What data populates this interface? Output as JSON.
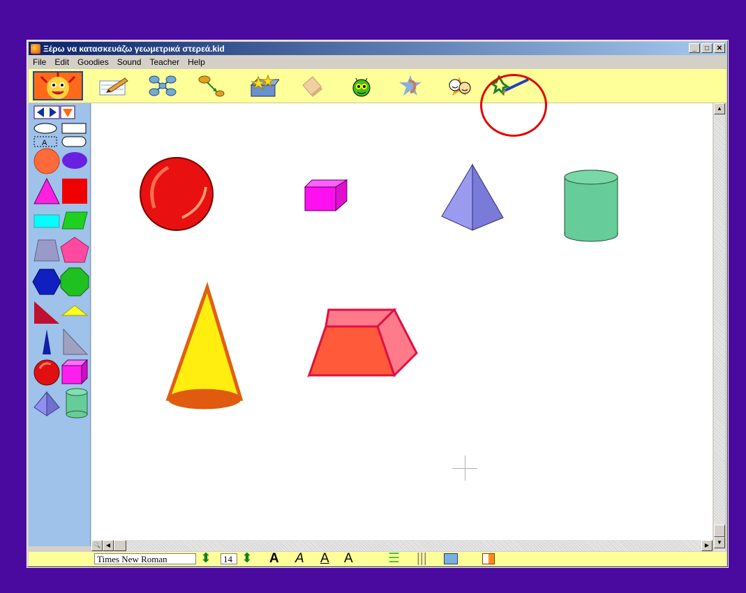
{
  "window": {
    "title": "Ξέρω να κατασκευάζω γεωμετρικά στερεά.kid",
    "controls": {
      "minimize": "_",
      "maximize": "□",
      "close": "✕"
    }
  },
  "menu": [
    "File",
    "Edit",
    "Goodies",
    "Sound",
    "Teacher",
    "Help"
  ],
  "toolbar": {
    "icons": [
      "mascot-icon",
      "pencil-paper-icon",
      "network-icon",
      "link-icon",
      "stamp-box-icon",
      "eraser-icon",
      "face-icon",
      "ear-icon",
      "masks-icon",
      "paintbrush-icon"
    ]
  },
  "sidebar": {
    "icons": [
      "left-arrow-icon",
      "right-arrow-icon",
      "down-triangle-icon",
      "ellipse-outline-icon",
      "rectangle-outline-icon",
      "text-box-icon",
      "rounded-rect-icon",
      "orange-circle-icon",
      "purple-ellipse-icon",
      "magenta-triangle-icon",
      "red-square-icon",
      "cyan-rectangle-icon",
      "green-parallelogram-icon",
      "trapezoid-icon",
      "pink-pentagon-icon",
      "blue-hexagon-icon",
      "green-octagon-icon",
      "right-triangle-icon",
      "yellow-triangle-icon",
      "tall-triangle-icon",
      "gray-triangle-icon",
      "sphere-icon",
      "cube-icon",
      "pyramid-icon",
      "cylinder-icon"
    ]
  },
  "canvas": {
    "shapes": [
      "sphere",
      "cube",
      "pyramid",
      "cylinder",
      "cone",
      "trapezoid-prism"
    ]
  },
  "format_bar": {
    "font_name": "Times New Roman",
    "font_size": "14",
    "bold": "A",
    "italic": "A",
    "underline": "A",
    "superscript": "A"
  },
  "colors": {
    "background": "#4a0aa0",
    "toolbar": "#ffff99",
    "sidebar": "#9ec2ea",
    "highlight": "#e00000"
  }
}
